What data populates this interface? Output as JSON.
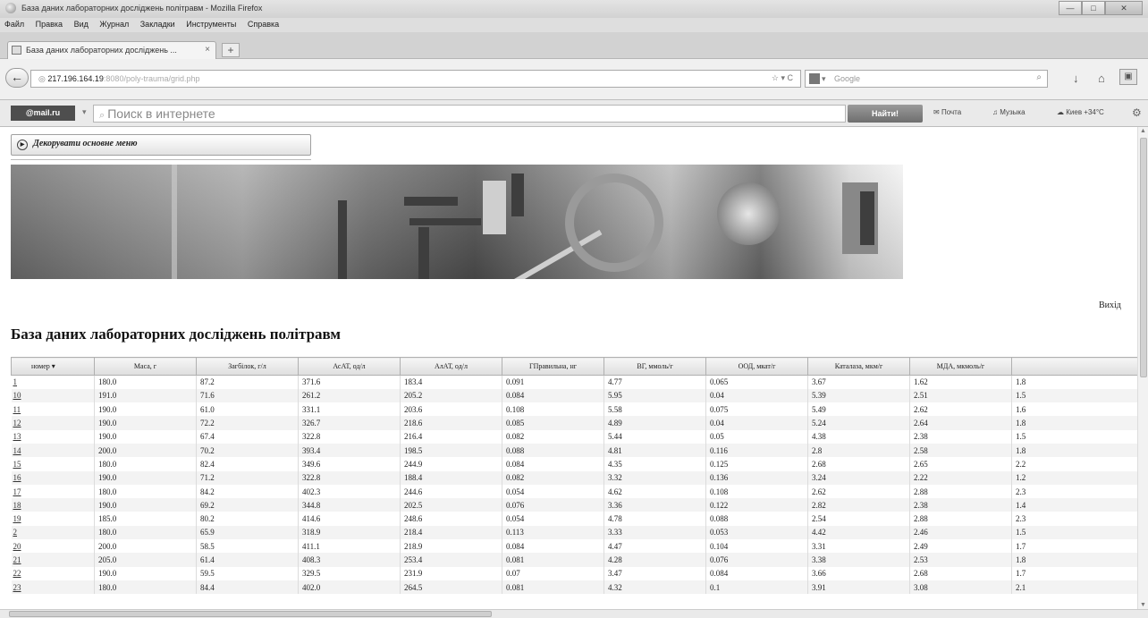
{
  "window": {
    "title": "База даних лабораторних досліджень політравм - Mozilla Firefox",
    "controls": [
      "—",
      "□",
      "✕"
    ]
  },
  "menubar": [
    "Файл",
    "Правка",
    "Вид",
    "Журнал",
    "Закладки",
    "Инструменты",
    "Справка"
  ],
  "tab": {
    "label": "База даних лабораторних досліджень ...",
    "new_tab": "+"
  },
  "nav": {
    "url_host": "217.196.164.19",
    "url_rest": ":8080/poly-trauma/grid.php",
    "reload": "☆ ▾ C",
    "search_placeholder": "Google",
    "search_engine_icon": "google-icon"
  },
  "mailru": {
    "logo": "@mail.ru",
    "dropdown": "▾",
    "search_placeholder": "Поиск в интернете",
    "find_button": "Найти!",
    "links": [
      "Почта",
      "Музыка",
      "Киев +34°С"
    ]
  },
  "page": {
    "menu_button": "Декорувати основне меню",
    "exit_link": "Вихід",
    "title": "База даних лабораторних досліджень політравм"
  },
  "table": {
    "columns": [
      "номер",
      "Маса, г",
      "Загбілок, г/л",
      "АсАТ, од/л",
      "АлАТ, од/л",
      "ГПравильна, нг",
      "ВГ, ммоль/г",
      "ООД, мкат/г",
      "Каталаза, мкм/г",
      "МДА, мкмоль/г"
    ],
    "rows": [
      [
        "1",
        "180.0",
        "87.2",
        "371.6",
        "183.4",
        "0.091",
        "4.77",
        "0.065",
        "3.67",
        "1.62",
        "1.8"
      ],
      [
        "10",
        "191.0",
        "71.6",
        "261.2",
        "205.2",
        "0.084",
        "5.95",
        "0.04",
        "5.39",
        "2.51",
        "1.5"
      ],
      [
        "11",
        "190.0",
        "61.0",
        "331.1",
        "203.6",
        "0.108",
        "5.58",
        "0.075",
        "5.49",
        "2.62",
        "1.6"
      ],
      [
        "12",
        "190.0",
        "72.2",
        "326.7",
        "218.6",
        "0.085",
        "4.89",
        "0.04",
        "5.24",
        "2.64",
        "1.8"
      ],
      [
        "13",
        "190.0",
        "67.4",
        "322.8",
        "216.4",
        "0.082",
        "5.44",
        "0.05",
        "4.38",
        "2.38",
        "1.5"
      ],
      [
        "14",
        "200.0",
        "70.2",
        "393.4",
        "198.5",
        "0.088",
        "4.81",
        "0.116",
        "2.8",
        "2.58",
        "1.8"
      ],
      [
        "15",
        "180.0",
        "82.4",
        "349.6",
        "244.9",
        "0.084",
        "4.35",
        "0.125",
        "2.68",
        "2.65",
        "2.2"
      ],
      [
        "16",
        "190.0",
        "71.2",
        "322.8",
        "188.4",
        "0.082",
        "3.32",
        "0.136",
        "3.24",
        "2.22",
        "1.2"
      ],
      [
        "17",
        "180.0",
        "84.2",
        "402.3",
        "244.6",
        "0.054",
        "4.62",
        "0.108",
        "2.62",
        "2.88",
        "2.3"
      ],
      [
        "18",
        "190.0",
        "69.2",
        "344.8",
        "202.5",
        "0.076",
        "3.36",
        "0.122",
        "2.82",
        "2.38",
        "1.4"
      ],
      [
        "19",
        "185.0",
        "80.2",
        "414.6",
        "248.6",
        "0.054",
        "4.78",
        "0.088",
        "2.54",
        "2.88",
        "2.3"
      ],
      [
        "2",
        "180.0",
        "65.9",
        "318.9",
        "218.4",
        "0.113",
        "3.33",
        "0.053",
        "4.42",
        "2.46",
        "1.5"
      ],
      [
        "20",
        "200.0",
        "58.5",
        "411.1",
        "218.9",
        "0.084",
        "4.47",
        "0.104",
        "3.31",
        "2.49",
        "1.7"
      ],
      [
        "21",
        "205.0",
        "61.4",
        "408.3",
        "253.4",
        "0.081",
        "4.28",
        "0.076",
        "3.38",
        "2.53",
        "1.8"
      ],
      [
        "22",
        "190.0",
        "59.5",
        "329.5",
        "231.9",
        "0.07",
        "3.47",
        "0.084",
        "3.66",
        "2.68",
        "1.7"
      ],
      [
        "23",
        "180.0",
        "84.4",
        "402.0",
        "264.5",
        "0.081",
        "4.32",
        "0.1",
        "3.91",
        "3.08",
        "2.1"
      ]
    ]
  }
}
